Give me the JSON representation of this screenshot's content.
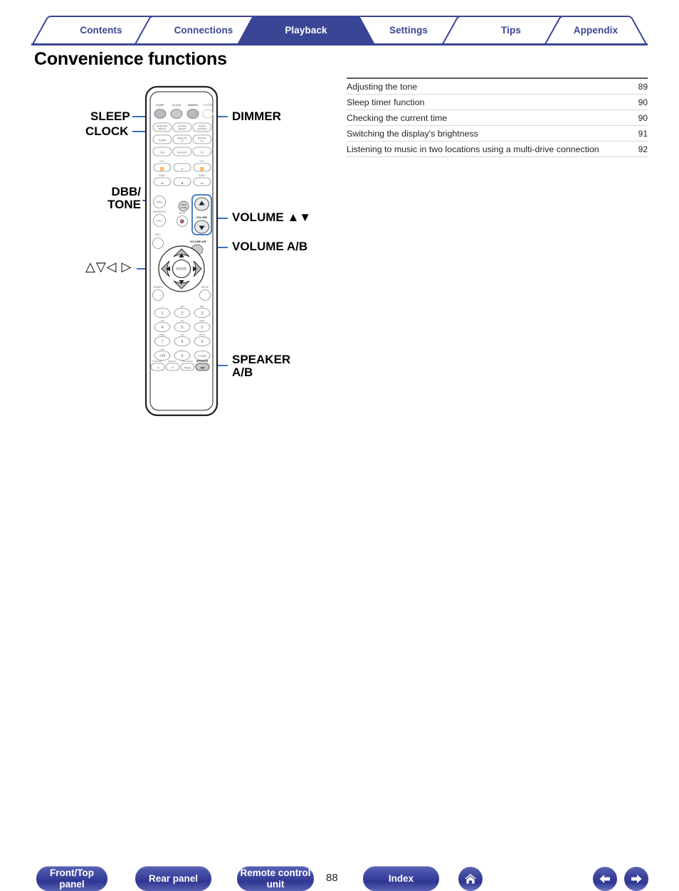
{
  "tabs": [
    {
      "label": "Contents",
      "active": false
    },
    {
      "label": "Connections",
      "active": false
    },
    {
      "label": "Playback",
      "active": true
    },
    {
      "label": "Settings",
      "active": false
    },
    {
      "label": "Tips",
      "active": false
    },
    {
      "label": "Appendix",
      "active": false
    }
  ],
  "page": {
    "title": "Convenience functions",
    "number": "88"
  },
  "toc": [
    {
      "title": "Adjusting the tone",
      "page": "89"
    },
    {
      "title": "Sleep timer function",
      "page": "90"
    },
    {
      "title": "Checking the current time",
      "page": "90"
    },
    {
      "title": "Switching the display's brightness",
      "page": "91"
    },
    {
      "title": "Listening to music in two locations using a multi-drive connection",
      "page": "92"
    }
  ],
  "callouts": {
    "sleep": "SLEEP",
    "clock": "CLOCK",
    "dbb_tone_line1": "DBB/",
    "dbb_tone_line2": "TONE",
    "cursor": "△▽◁ ▷",
    "dimmer": "DIMMER",
    "volume_updown": "VOLUME ▲▼",
    "volume_ab": "VOLUME A/B",
    "speaker_line1": "SPEAKER",
    "speaker_line2": "A/B"
  },
  "remote": {
    "top_row": [
      "SLEEP",
      "CLOCK",
      "DIMMER",
      "POWER"
    ],
    "sources": [
      [
        "INTERNET RADIO",
        "ONLINE MUSIC",
        "MUSIC SERVER"
      ],
      [
        "TUNER",
        "ANALOG IN",
        "DIGITAL IN"
      ],
      [
        "USB",
        "Bluetooth",
        "CD"
      ]
    ],
    "transport_labels": [
      "CH +",
      "CH +",
      "TUNE +",
      "TUNE +"
    ],
    "transport": [
      "◀◀",
      "▶/Ⅱ",
      "▶▶",
      "◀◀",
      "■",
      "▶▶"
    ],
    "fav_add": "ADD",
    "fav_label": "FAVORITES",
    "fav_call": "CALL",
    "dbb_tone": "DBB/TONE",
    "mute_label": "MUTE",
    "info_label": "INFO",
    "volume_label": "VOLUME",
    "volume_ab_label": "VOLUME A/B",
    "enter": "ENTER",
    "search_label": "SEARCH",
    "setup_label": "SETUP",
    "numpad": [
      {
        "key": "1",
        "sub": ". / –"
      },
      {
        "key": "2",
        "sub": "ABC"
      },
      {
        "key": "3",
        "sub": "DEF"
      },
      {
        "key": "4",
        "sub": "GHI"
      },
      {
        "key": "5",
        "sub": "JKL"
      },
      {
        "key": "6",
        "sub": "MNO"
      },
      {
        "key": "7",
        "sub": "PQRS"
      },
      {
        "key": "8",
        "sub": "TUV"
      },
      {
        "key": "9",
        "sub": "WXYZ"
      },
      {
        "key": "+10",
        "sub": "a/A"
      },
      {
        "key": "0",
        "sub": "␣"
      },
      {
        "key": "CLEAR",
        "sub": ""
      }
    ],
    "bottom_labels": [
      "RANDOM",
      "REPEAT",
      "PROGRAM",
      "SPEAKER"
    ],
    "bottom_keys": [
      "⤨",
      "↻",
      "MODE",
      "A/B"
    ]
  },
  "footer": {
    "front_top_panel_l1": "Front/Top",
    "front_top_panel_l2": "panel",
    "rear_panel": "Rear panel",
    "remote_control_l1": "Remote control",
    "remote_control_l2": "unit",
    "index": "Index"
  },
  "colors": {
    "brand_blue": "#3a4595",
    "callout_line": "#3a6fc4",
    "rule_gray": "#58595b",
    "text": "#231f20"
  }
}
